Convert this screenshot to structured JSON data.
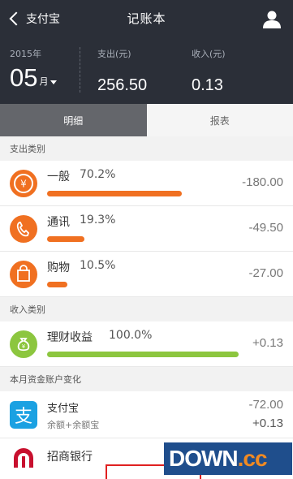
{
  "header": {
    "back_label": "支付宝",
    "title": "记账本"
  },
  "summary": {
    "year": "2015年",
    "month": "05",
    "month_unit": "月",
    "expense_label": "支出(元)",
    "expense_value": "256.50",
    "income_label": "收入(元)",
    "income_value": "0.13"
  },
  "tabs": [
    {
      "label": "明细",
      "active": true
    },
    {
      "label": "报表",
      "active": false
    }
  ],
  "expense_section": {
    "title": "支出类别",
    "items": [
      {
        "name": "一般",
        "percent": "70.2%",
        "share": 0.702,
        "amount": "-180.00",
        "icon": "yuan-icon",
        "color": "#f07021"
      },
      {
        "name": "通讯",
        "percent": "19.3%",
        "share": 0.193,
        "amount": "-49.50",
        "icon": "phone-icon",
        "color": "#f07021"
      },
      {
        "name": "购物",
        "percent": "10.5%",
        "share": 0.105,
        "amount": "-27.00",
        "icon": "shopping-bag-icon",
        "color": "#f07021"
      }
    ]
  },
  "income_section": {
    "title": "收入类别",
    "items": [
      {
        "name": "理财收益",
        "percent": "100.0%",
        "share": 1.0,
        "amount": "+0.13",
        "icon": "money-bag-icon",
        "color": "#8cc63f"
      }
    ]
  },
  "account_section": {
    "title": "本月资金账户变化",
    "items": [
      {
        "name": "支付宝",
        "sub": "余额+余额宝",
        "out": "-72.00",
        "in": "+0.13",
        "icon": "alipay-icon",
        "icon_glyph": "支"
      },
      {
        "name": "招商银行",
        "icon": "cmb-logo-icon"
      }
    ]
  },
  "watermark": {
    "text": "DOWN",
    "suffix": ".cc"
  },
  "colors": {
    "header_bg": "#2b2f38",
    "expense": "#f07021",
    "income": "#8cc63f",
    "alipay": "#1ba1e2"
  }
}
